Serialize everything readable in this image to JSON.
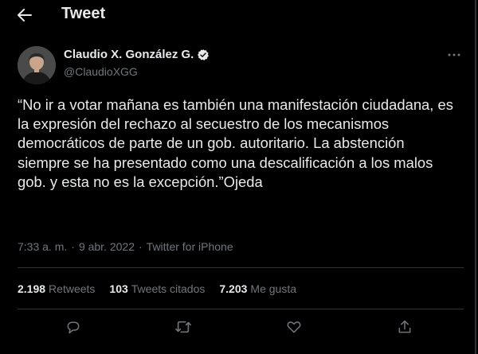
{
  "header": {
    "title": "Tweet"
  },
  "author": {
    "name": "Claudio X. González G.",
    "handle": "@ClaudioXGG"
  },
  "tweet": {
    "text": "“No ir a votar mañana es también una manifestación ciudadana, es la expresión del rechazo al secuestro de los mecanismos democráticos de parte de un gob. autoritario. La abstención siempre se ha presentado como una descalificación a los malos gob. y esta no es la excepción.”Ojeda"
  },
  "meta": {
    "time": "7:33 a. m.",
    "sep1": "·",
    "date": "9 abr. 2022",
    "sep2": "·",
    "source": "Twitter for iPhone"
  },
  "stats": {
    "retweets": {
      "count": "2.198",
      "label": "Retweets"
    },
    "quotes": {
      "count": "103",
      "label": "Tweets citados"
    },
    "likes": {
      "count": "7.203",
      "label": "Me gusta"
    }
  },
  "icons": {
    "back": "arrow-left-icon",
    "verified": "verified-badge-icon",
    "more": "more-horizontal-icon",
    "reply": "reply-icon",
    "retweet": "retweet-icon",
    "like": "heart-icon",
    "share": "share-icon"
  },
  "colors": {
    "background": "#000000",
    "text": "#e7e9ea",
    "secondary": "#71767b",
    "border": "#2f3336"
  }
}
